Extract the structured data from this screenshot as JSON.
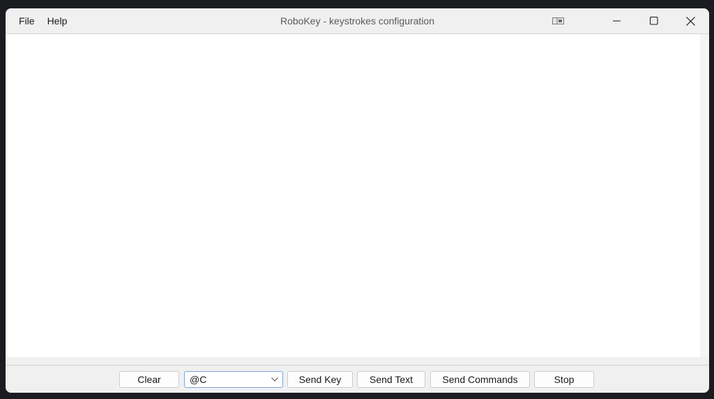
{
  "window": {
    "title": "RoboKey - keystrokes configuration"
  },
  "menu": {
    "items": [
      {
        "label": "File"
      },
      {
        "label": "Help"
      }
    ]
  },
  "titlebar_icons": {
    "snap": "snap-layout-icon",
    "minimize": "minimize-icon",
    "maximize": "maximize-icon",
    "close": "close-icon"
  },
  "editor": {
    "content": ""
  },
  "toolbar": {
    "clear_label": "Clear",
    "combo_value": "@C",
    "send_key_label": "Send Key",
    "send_text_label": "Send Text",
    "send_commands_label": "Send Commands",
    "stop_label": "Stop"
  }
}
